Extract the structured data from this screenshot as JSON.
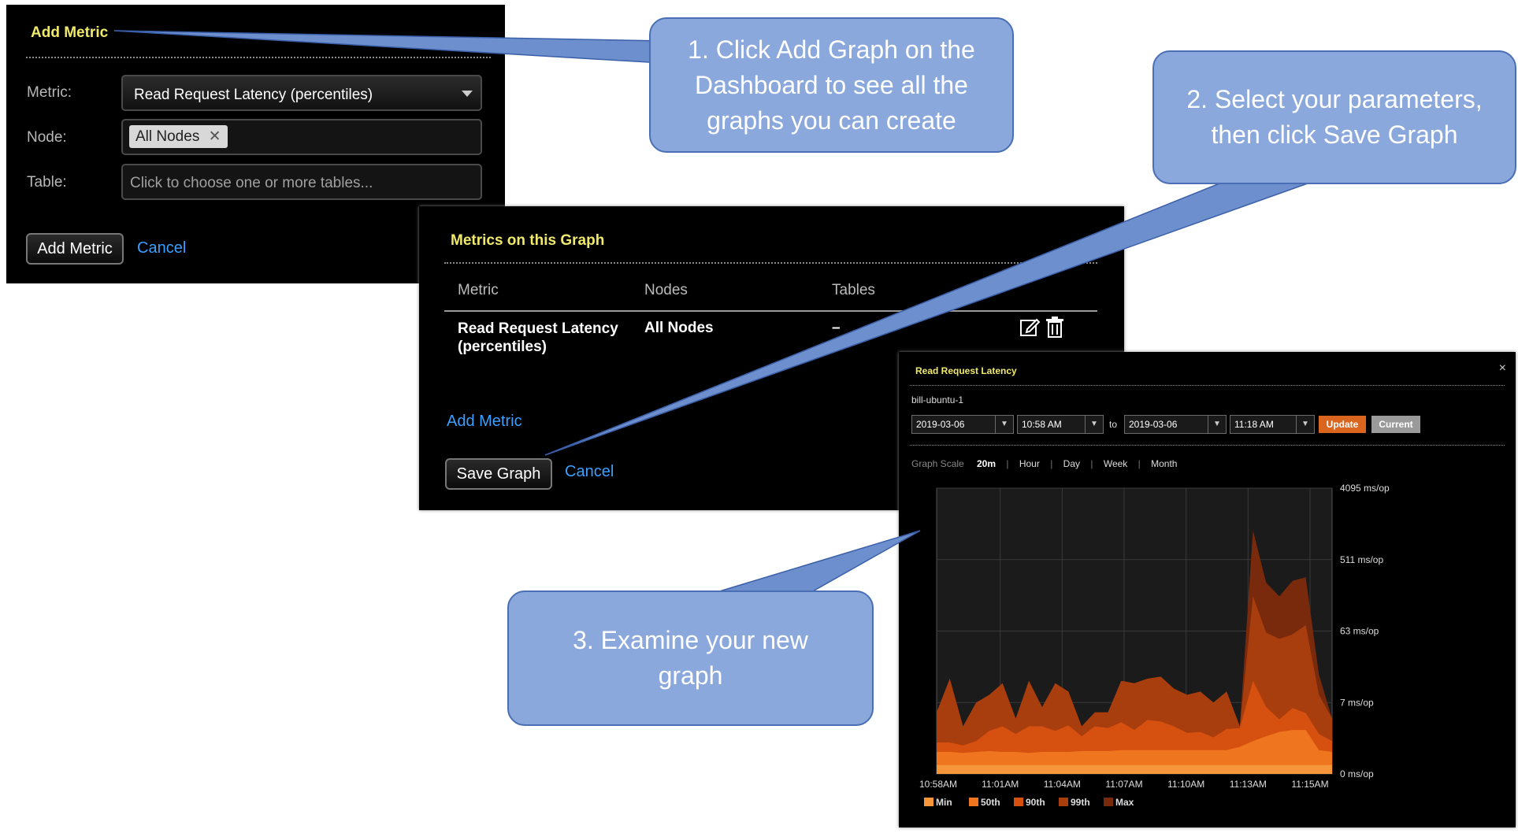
{
  "add_metric_panel": {
    "title": "Add Metric",
    "metric_label": "Metric:",
    "metric_value": "Read Request Latency (percentiles)",
    "node_label": "Node:",
    "node_tag": "All Nodes",
    "table_label": "Table:",
    "table_placeholder": "Click to choose one or more tables...",
    "add_button": "Add Metric",
    "cancel": "Cancel"
  },
  "metrics_panel": {
    "title": "Metrics on this Graph",
    "columns": [
      "Metric",
      "Nodes",
      "Tables"
    ],
    "row": {
      "metric": "Read Request Latency\n(percentiles)",
      "nodes": "All Nodes",
      "tables": "–"
    },
    "add_metric": "Add Metric",
    "save_button": "Save Graph",
    "cancel": "Cancel"
  },
  "graph_panel": {
    "title": "Read Request Latency",
    "close": "×",
    "node": "bill-ubuntu-1",
    "from_date": "2019-03-06",
    "from_time": "10:58 AM",
    "to_label": "to",
    "to_date": "2019-03-06",
    "to_time": "11:18 AM",
    "update": "Update",
    "current": "Current",
    "scale_label": "Graph Scale",
    "scales": [
      "20m",
      "Hour",
      "Day",
      "Week",
      "Month"
    ]
  },
  "chart_data": {
    "type": "area",
    "title": "Read Request Latency",
    "x": [
      "10:58AM",
      "11:01AM",
      "11:04AM",
      "11:07AM",
      "11:10AM",
      "11:13AM",
      "11:15AM"
    ],
    "y_ticks": [
      "4095 ms/op",
      "511 ms/op",
      "63 ms/op",
      "7 ms/op",
      "0 ms/op"
    ],
    "y_scale": "log",
    "ylim": [
      0,
      4095
    ],
    "grid": true,
    "legend_position": "bottom",
    "series": [
      {
        "name": "Max",
        "color": "#7a2a0c",
        "values": [
          5,
          15,
          3,
          7,
          9,
          13,
          4,
          14,
          6,
          13,
          10,
          3,
          5,
          5,
          14,
          13,
          15,
          16,
          11,
          9,
          10,
          7,
          10,
          3,
          1190,
          260,
          175,
          275,
          305,
          17,
          4
        ]
      },
      {
        "name": "99th",
        "color": "#a83d0d",
        "values": [
          5,
          15,
          3,
          7,
          9,
          13,
          4,
          14,
          6,
          13,
          10,
          3,
          5,
          5,
          14,
          13,
          15,
          16,
          11,
          9,
          10,
          7,
          10,
          3,
          175,
          60,
          50,
          57,
          75,
          9,
          4
        ]
      },
      {
        "name": "90th",
        "color": "#d6500f",
        "values": [
          1.5,
          1.5,
          1.3,
          1.6,
          2.5,
          3,
          2.2,
          3,
          3,
          2.5,
          3.1,
          2,
          3,
          2.8,
          3.5,
          2.6,
          3.8,
          3.6,
          3,
          2.3,
          2.4,
          1.9,
          2.7,
          2.8,
          14,
          6,
          3.9,
          5.8,
          4.9,
          2.2,
          1.6
        ]
      },
      {
        "name": "50th",
        "color": "#f0751f",
        "values": [
          0.9,
          0.9,
          0.85,
          0.9,
          0.95,
          0.9,
          0.9,
          0.85,
          0.9,
          0.9,
          0.9,
          0.95,
          0.95,
          0.95,
          1,
          1,
          1,
          1,
          1,
          1,
          1,
          1,
          1,
          1.2,
          1.6,
          2,
          2.4,
          2.6,
          2.6,
          1,
          0.9
        ]
      },
      {
        "name": "Min",
        "color": "#f6963a",
        "values": [
          0.3,
          0.3,
          0.3,
          0.3,
          0.3,
          0.3,
          0.3,
          0.3,
          0.3,
          0.3,
          0.3,
          0.3,
          0.3,
          0.3,
          0.3,
          0.3,
          0.3,
          0.3,
          0.3,
          0.3,
          0.3,
          0.3,
          0.3,
          0.3,
          0.3,
          0.3,
          0.3,
          0.3,
          0.3,
          0.3,
          0.3
        ]
      }
    ],
    "legend": [
      "Min",
      "50th",
      "90th",
      "99th",
      "Max"
    ]
  },
  "callouts": [
    "1. Click Add Graph on the\nDashboard to see all the\ngraphs you can create",
    "2. Select your parameters,\nthen click Save Graph",
    "3. Examine your new\ngraph"
  ]
}
